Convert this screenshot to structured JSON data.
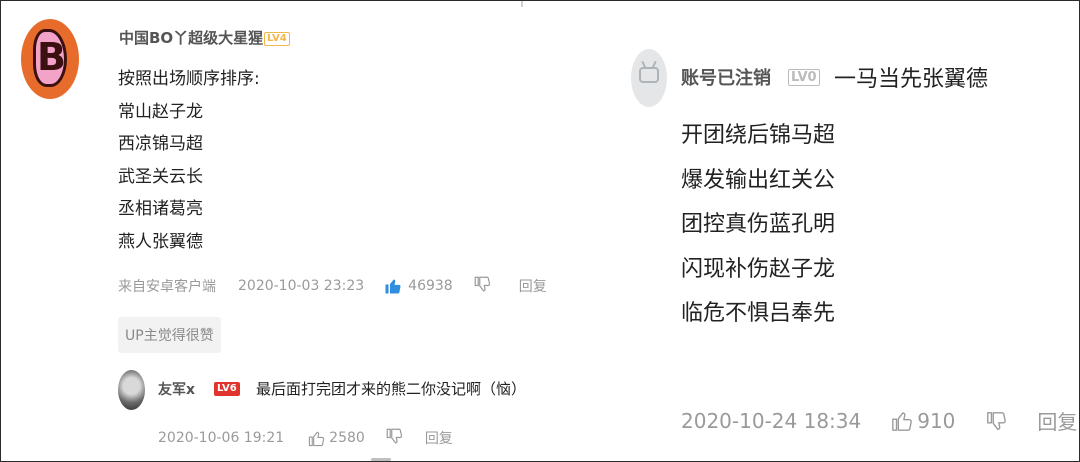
{
  "comment1": {
    "username": "中国BO丫超级大星猩",
    "level": "LV4",
    "lines": [
      "按照出场顺序排序:",
      "常山赵子龙",
      "西凉锦马超",
      "武圣关云长",
      "丞相诸葛亮",
      "燕人张翼德"
    ],
    "source": "来自安卓客户端",
    "time": "2020-10-03 23:23",
    "likes": "46938",
    "reply_label": "回复",
    "up_badge": "UP主觉得很赞",
    "accent": "#2f8ee0"
  },
  "reply1": {
    "username": "友军x",
    "level": "LV6",
    "text": "最后面打完团才来的熊二你没记啊（恼）",
    "time": "2020-10-06 19:21",
    "likes": "2580",
    "reply_label": "回复"
  },
  "comment2": {
    "username": "账号已注销",
    "level": "LV0",
    "head": "一马当先张翼德",
    "lines": [
      "开团绕后锦马超",
      "爆发输出红关公",
      "团控真伤蓝孔明",
      "闪现补伤赵子龙",
      "临危不惧吕奉先"
    ],
    "time": "2020-10-24 18:34",
    "likes": "910",
    "reply_label": "回复"
  },
  "icons": {
    "like": "thumb-up-icon",
    "dislike": "thumb-down-icon"
  }
}
